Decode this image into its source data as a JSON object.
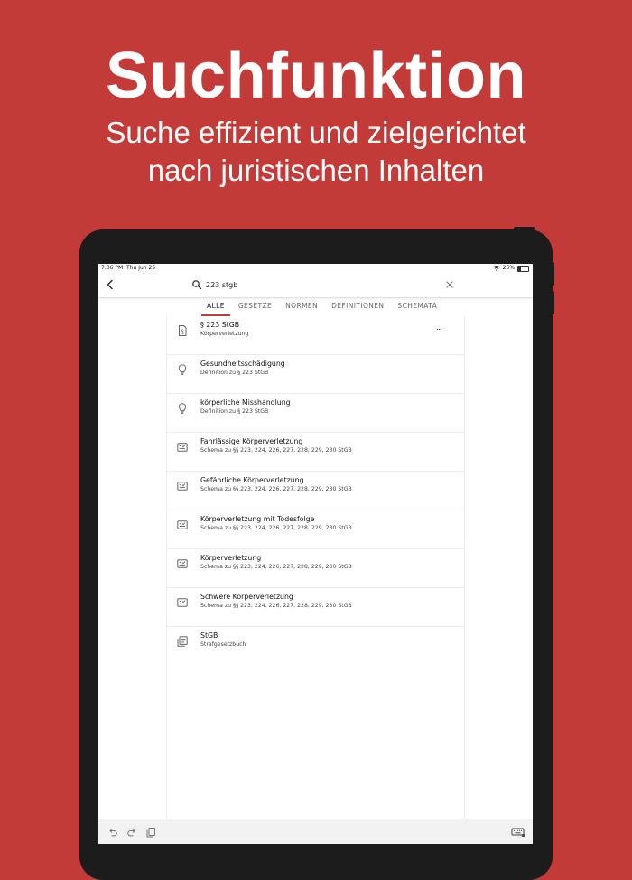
{
  "hero": {
    "title": "Suchfunktion",
    "subtitle_line1": "Suche effizient und zielgerichtet",
    "subtitle_line2": "nach juristischen Inhalten"
  },
  "colors": {
    "brand": "#c23b38",
    "bezel": "#1c1c1c",
    "divider": "#ececec"
  },
  "status_bar": {
    "time": "7:06 PM",
    "date": "Thu Jun 25",
    "battery": "25%"
  },
  "search": {
    "query": "223 stgb"
  },
  "tabs": [
    {
      "label": "ALLE",
      "active": true
    },
    {
      "label": "GESETZE"
    },
    {
      "label": "NORMEN"
    },
    {
      "label": "DEFINITIONEN"
    },
    {
      "label": "SCHEMATA"
    }
  ],
  "results": [
    {
      "icon": "norm-icon",
      "title": "§ 223 StGB",
      "subtitle": "Körperverletzung",
      "more": "..."
    },
    {
      "icon": "lightbulb-icon",
      "title": "Gesundheitsschädigung",
      "subtitle": "Definition zu § 223 StGB"
    },
    {
      "icon": "lightbulb-icon",
      "title": "körperliche Misshandlung",
      "subtitle": "Definition zu § 223 StGB"
    },
    {
      "icon": "schema-icon",
      "title": "Fahrlässige Körperverletzung",
      "subtitle": "Schema zu §§ 223, 224, 226, 227, 228, 229, 230 StGB"
    },
    {
      "icon": "schema-icon",
      "title": "Gefährliche Körperverletzung",
      "subtitle": "Schema zu §§ 223, 224, 226, 227, 228, 229, 230 StGB"
    },
    {
      "icon": "schema-icon",
      "title": "Körperverletzung mit Todesfolge",
      "subtitle": "Schema zu §§ 223, 224, 226, 227, 228, 229, 230 StGB"
    },
    {
      "icon": "schema-icon",
      "title": "Körperverletzung",
      "subtitle": "Schema zu §§ 223, 224, 226, 227, 228, 229, 230 StGB"
    },
    {
      "icon": "schema-icon",
      "title": "Schwere Körperverletzung",
      "subtitle": "Schema zu §§ 223, 224, 226, 227, 228, 229, 230 StGB"
    },
    {
      "icon": "law-book-icon",
      "title": "StGB",
      "subtitle": "Strafgesetzbuch"
    }
  ]
}
